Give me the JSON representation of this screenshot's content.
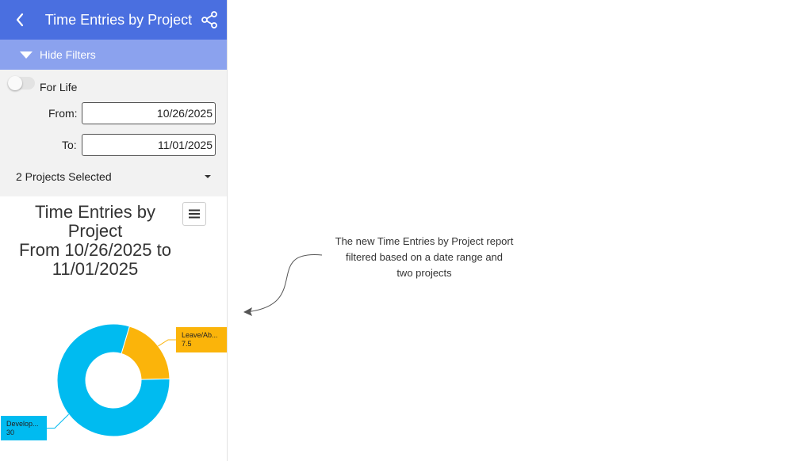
{
  "header": {
    "title": "Time Entries by Project",
    "back_icon": "chevron-left-icon",
    "share_icon": "share-icon",
    "color": "#4a6fe0"
  },
  "filter_bar": {
    "label": "Hide Filters",
    "color": "#8ba2ee"
  },
  "filters": {
    "for_life_label": "For Life",
    "for_life_on": false,
    "from_label": "From:",
    "from_value": "10/26/2025",
    "to_label": "To:",
    "to_value": "11/01/2025",
    "projects_label": "2 Projects Selected"
  },
  "chart_title_lines": [
    "Time Entries by",
    "Project",
    "From 10/26/2025 to",
    "11/01/2025"
  ],
  "chart_data": {
    "type": "pie",
    "title": "Time Entries by Project From 10/26/2025 to 11/01/2025",
    "donut": true,
    "categories": [
      "Leave/Ab...",
      "Develop..."
    ],
    "values": [
      7.5,
      30
    ],
    "colors": [
      "#fbb40a",
      "#00bbf0"
    ]
  },
  "annotation": {
    "lines": [
      "The new Time Entries by Project report",
      "filtered based on a date range and",
      "two projects"
    ]
  }
}
